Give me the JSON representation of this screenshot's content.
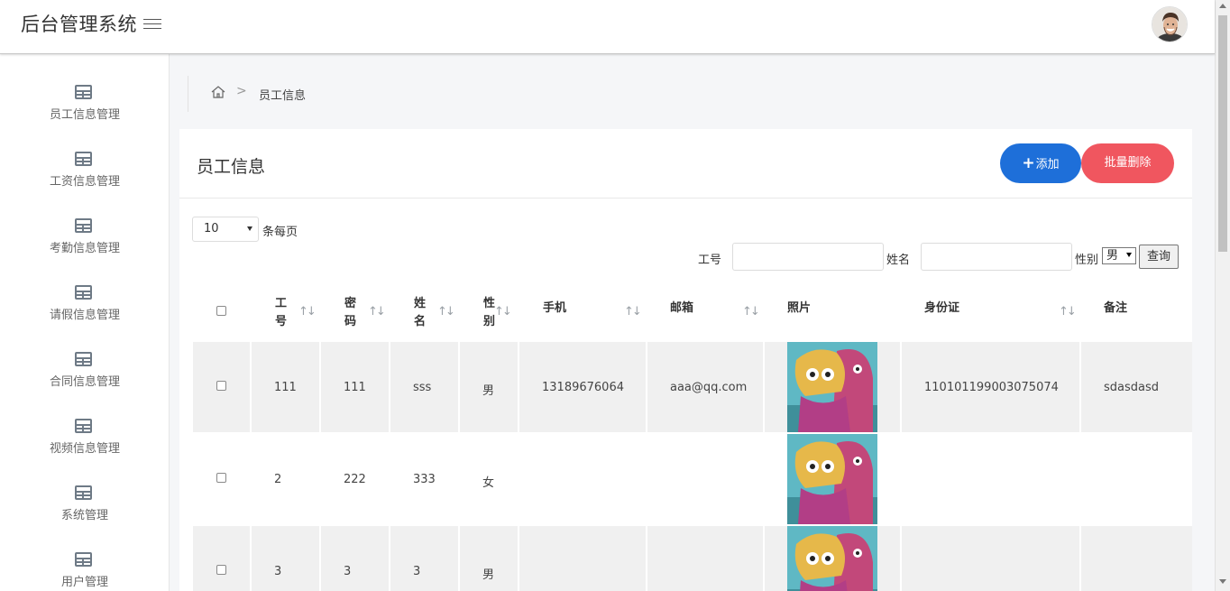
{
  "header": {
    "app_title": "后台管理系统",
    "menu_icon": "hamburger-icon",
    "avatar_icon": "user-avatar"
  },
  "sidebar": {
    "items": [
      {
        "label": "员工信息管理",
        "icon": "table-icon"
      },
      {
        "label": "工资信息管理",
        "icon": "table-icon"
      },
      {
        "label": "考勤信息管理",
        "icon": "table-icon"
      },
      {
        "label": "请假信息管理",
        "icon": "table-icon"
      },
      {
        "label": "合同信息管理",
        "icon": "table-icon"
      },
      {
        "label": "视频信息管理",
        "icon": "table-icon"
      },
      {
        "label": "系统管理",
        "icon": "table-icon"
      },
      {
        "label": "用户管理",
        "icon": "table-icon"
      }
    ]
  },
  "breadcrumb": {
    "home_icon": "home-icon",
    "separator": ">",
    "current": "员工信息"
  },
  "panel": {
    "title": "员工信息",
    "add_label": "添加",
    "add_icon": "+",
    "batch_delete_label": "批量删除"
  },
  "pagination": {
    "page_size": "10",
    "page_size_suffix": "条每页"
  },
  "filters": {
    "id_label": "工号",
    "id_value": "",
    "name_label": "姓名",
    "name_value": "",
    "gender_label": "性别",
    "gender_value": "男",
    "query_label": "查询"
  },
  "table": {
    "sort_glyph": "↑↓",
    "columns": [
      "工号",
      "密码",
      "姓名",
      "性别",
      "手机",
      "邮箱",
      "照片",
      "身份证",
      "备注"
    ],
    "rows": [
      {
        "id": "111",
        "password": "111",
        "name": "sss",
        "gender": "男",
        "phone": "13189676064",
        "email": "aaa@qq.com",
        "photo": "cartoon-photo",
        "id_card": "110101199003075074",
        "remark": "sdasdasd"
      },
      {
        "id": "2",
        "password": "222",
        "name": "333",
        "gender": "女",
        "phone": "",
        "email": "",
        "photo": "cartoon-photo",
        "id_card": "",
        "remark": ""
      },
      {
        "id": "3",
        "password": "3",
        "name": "3",
        "gender": "男",
        "phone": "",
        "email": "",
        "photo": "cartoon-photo",
        "id_card": "",
        "remark": ""
      }
    ]
  },
  "colors": {
    "add_button": "#1e6fd9",
    "delete_button": "#f0565f",
    "odd_row": "#f0f0f0"
  }
}
